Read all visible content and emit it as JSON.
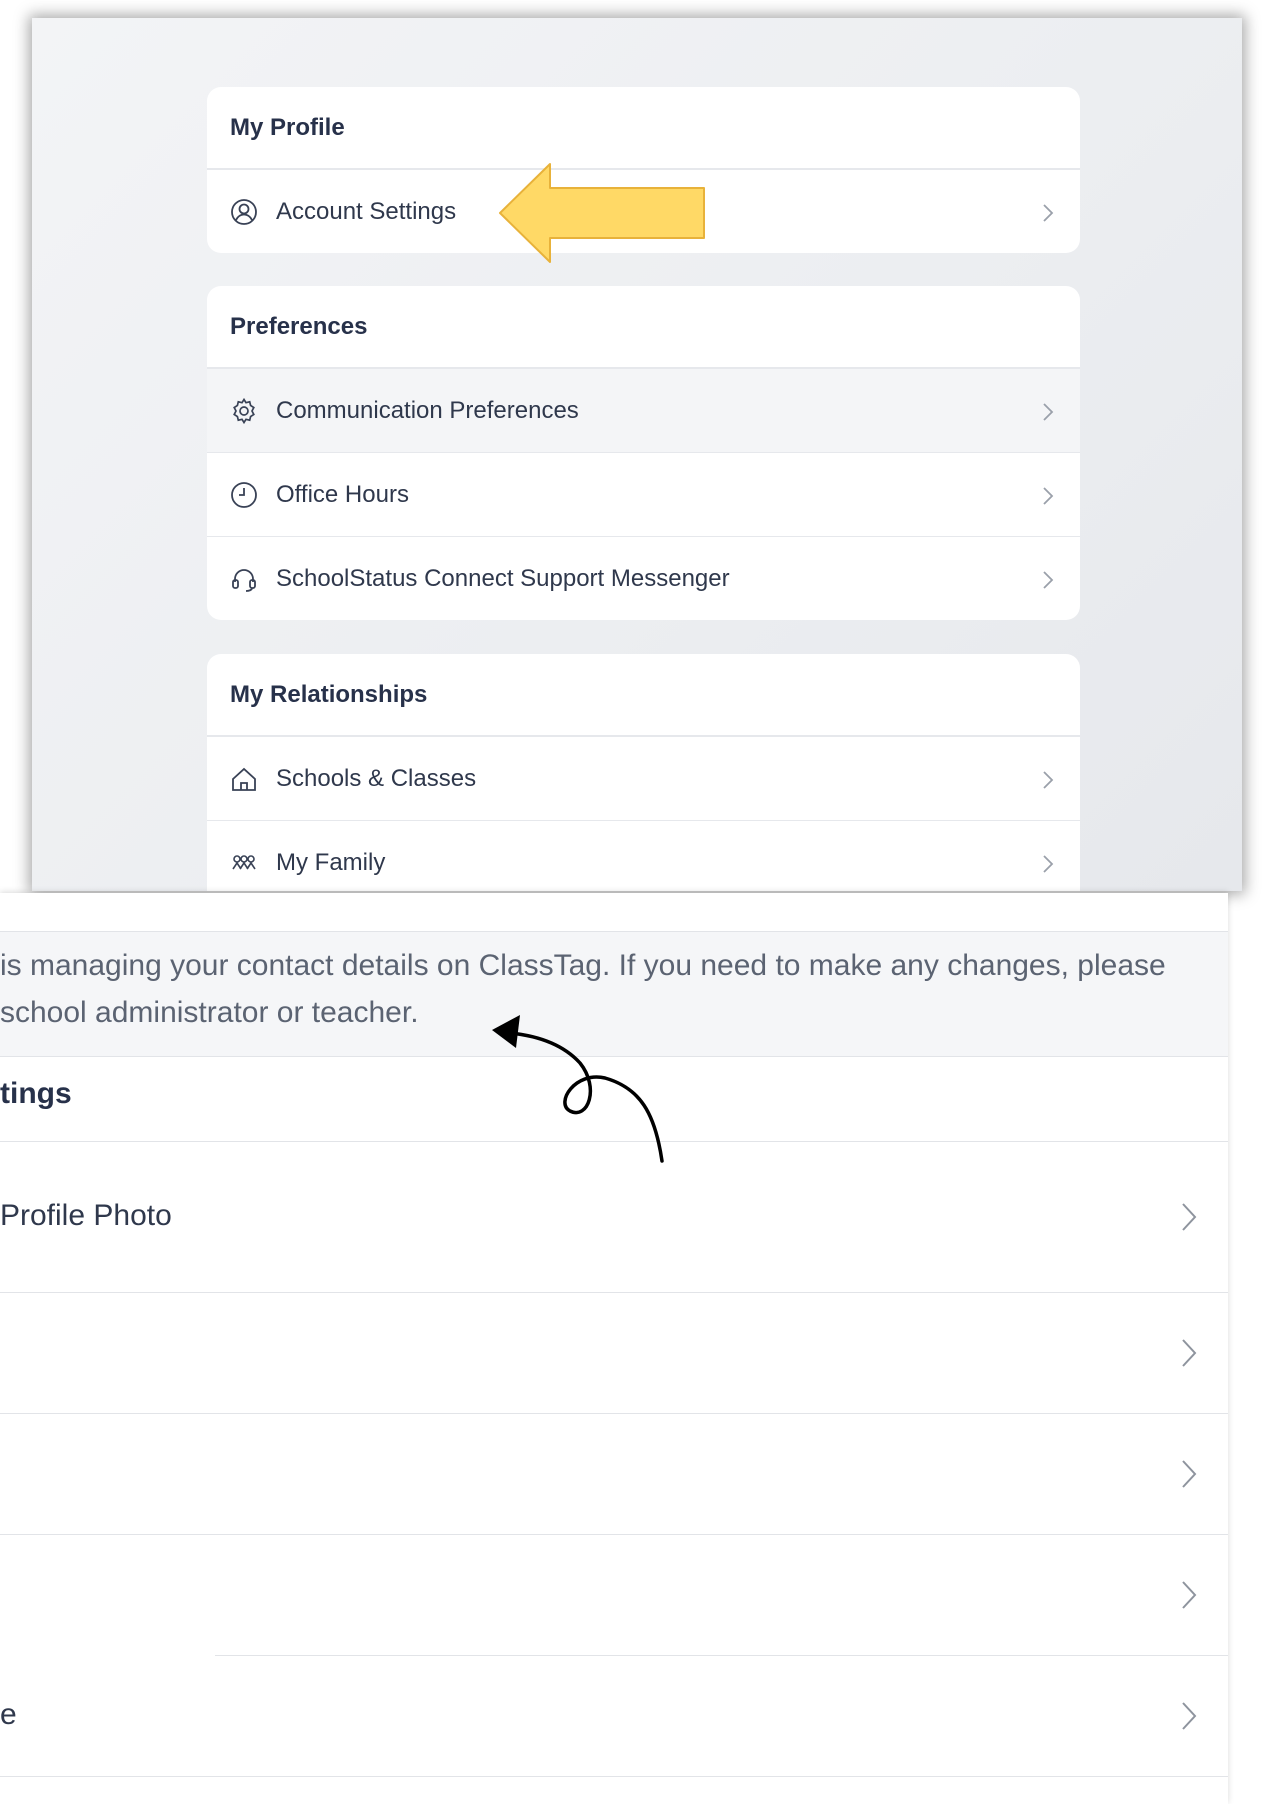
{
  "top": {
    "cards": [
      {
        "title": "My Profile",
        "rows": [
          {
            "label": "Account Settings",
            "icon": "user-circle-icon"
          }
        ]
      },
      {
        "title": "Preferences",
        "rows": [
          {
            "label": "Communication Preferences",
            "icon": "gear-icon"
          },
          {
            "label": "Office Hours",
            "icon": "clock-icon"
          },
          {
            "label": "SchoolStatus Connect Support Messenger",
            "icon": "headset-icon"
          }
        ]
      },
      {
        "title": "My Relationships",
        "rows": [
          {
            "label": "Schools & Classes",
            "icon": "home-icon"
          },
          {
            "label": "My Family",
            "icon": "family-icon"
          }
        ]
      }
    ],
    "annotation_color": "#FFD966"
  },
  "bottom": {
    "notice_line1": "is managing your contact details on ClassTag. If you need to make any changes, please",
    "notice_line2": "school administrator or teacher.",
    "section_title": "tings",
    "rows": [
      {
        "label": "Profile Photo"
      },
      {
        "label": ""
      },
      {
        "label": ""
      },
      {
        "label": ""
      },
      {
        "label": "e"
      }
    ]
  },
  "colors": {
    "heading": "#27314a",
    "text": "#2f384c",
    "muted": "#5b6372",
    "chevron": "#9aa0aa",
    "divider": "#e6e8ec"
  }
}
